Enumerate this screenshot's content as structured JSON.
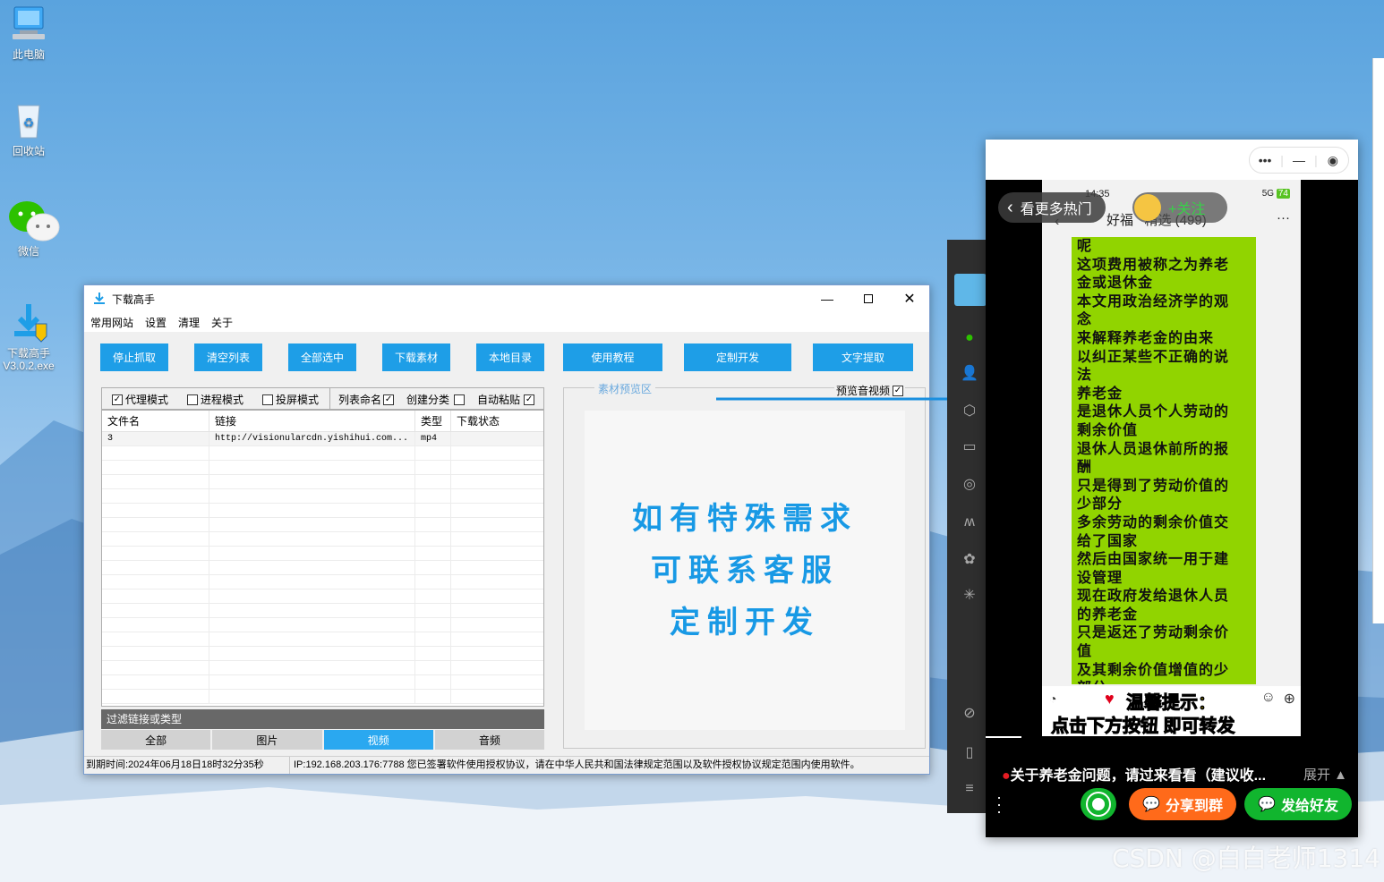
{
  "desktop": {
    "icons": [
      {
        "label": "此电脑"
      },
      {
        "label": "回收站"
      },
      {
        "label": "微信"
      },
      {
        "label": "下载高手\nV3.0.2.exe"
      }
    ],
    "watermark": "CSDN @白白老师1314"
  },
  "app": {
    "title": "下载高手",
    "menu": [
      "常用网站",
      "设置",
      "清理",
      "关于"
    ],
    "window_controls": [
      "minimize-icon",
      "maximize-icon",
      "close-icon"
    ],
    "buttons": [
      "停止抓取",
      "清空列表",
      "全部选中",
      "下载素材",
      "本地目录",
      "使用教程",
      "定制开发",
      "文字提取"
    ],
    "options": [
      {
        "label": "代理模式",
        "checked": true
      },
      {
        "label": "进程模式",
        "checked": false
      },
      {
        "label": "投屏模式",
        "checked": false
      },
      {
        "label": "列表命名",
        "checked": true
      },
      {
        "label": "创建分类",
        "checked": false
      },
      {
        "label": "自动粘贴",
        "checked": true
      }
    ],
    "table": {
      "columns": [
        "文件名",
        "链接",
        "类型",
        "下载状态"
      ],
      "rows": [
        [
          "3",
          "http://visionularcdn.yishihui.com...",
          "mp4",
          ""
        ]
      ]
    },
    "filter_placeholder": "过滤链接或类型",
    "filter_tabs": [
      "全部",
      "图片",
      "视频",
      "音频"
    ],
    "active_filter": "视频",
    "preview": {
      "legend": "素材预览区",
      "checkbox_label": "预览音视频",
      "checkbox_checked": true,
      "promo_lines": [
        "如有特殊需求",
        "可联系客服",
        "定制开发"
      ]
    },
    "status": {
      "expiry": "到期时间:2024年06月18日18时32分35秒",
      "info": "IP:192.168.203.176:7788 您已签署软件使用授权协议，请在中华人民共和国法律规定范围以及软件授权协议规定范围内使用软件。"
    }
  },
  "phone": {
    "back_button": "看更多热门",
    "status_time": "14:35",
    "chat_title": "好福   精选 (499)",
    "follow": "+关注",
    "signal": "5G",
    "battery": "74",
    "text_lines": [
      "呢",
      "这项费用被称之为养老",
      "金或退休金",
      "本文用政治经济学的观",
      "念",
      "来解释养老金的由来",
      "以纠正某些不正确的说",
      "法",
      "养老金",
      "是退休人员个人劳动的",
      "剩余价值",
      "退休人员退休前所的报",
      "酬",
      "只是得到了劳动价值的",
      "少部分",
      "多余劳动的剩余价值交",
      "给了国家",
      "然后由国家统一用于建",
      "设管理",
      "现在政府发给退休人员",
      "的养老金",
      "只是返还了劳动剩余价",
      "值",
      "及其剩余价值增值的少",
      "部分"
    ],
    "tip_line1": "温馨提示：",
    "tip_line2": "点击下方按钮 即可转发",
    "video_title": "关于养老金问题，请过来看看（建议收...",
    "expand": "展开",
    "share_group": "分享到群",
    "send_friend": "发给好友",
    "colors": {
      "green_box": "#91d400",
      "share_orange": "#ff6a1a",
      "send_green": "#11b52e"
    }
  }
}
